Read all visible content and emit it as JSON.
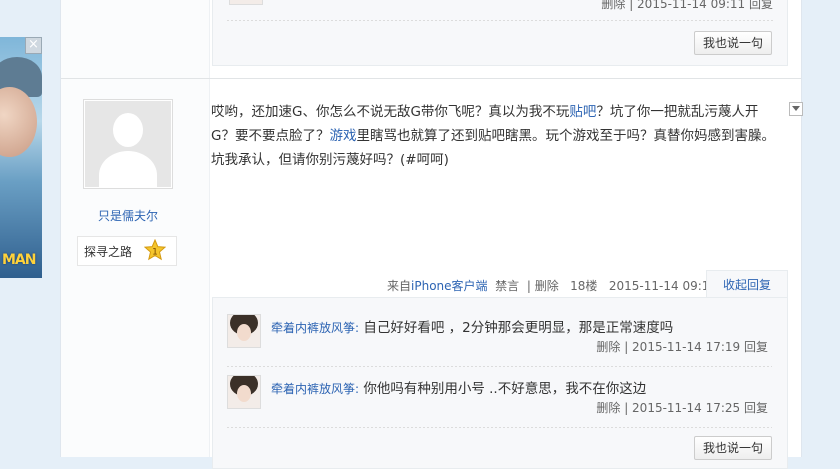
{
  "ad": {
    "close": "×",
    "logo": "MAN"
  },
  "top_reply": {
    "meta": "删除 | 2015-11-14 09:11 回复"
  },
  "reply_btn_label": "我也说一句",
  "post": {
    "author": "只是儒夫尔",
    "badge": "探寻之路",
    "badge_level": "1",
    "content_parts": [
      "哎哟，还加速G、你怎么不说无敌G带你飞呢？真以为我不玩",
      "贴吧",
      "？坑了你一把就乱污蔑人开G？要不要点脸了？",
      "游戏",
      "里瞎骂也就算了还到贴吧瞎黑。玩个游戏至于吗？真替你妈感到害臊。坑我承认，但请你别污蔑好吗？(#呵呵)"
    ],
    "meta": {
      "source_prefix": "来自",
      "source": "iPhone客户端",
      "ban": "禁言",
      "delete": "删除",
      "floor": "18楼",
      "time": "2015-11-14 09:15"
    },
    "collapse": "收起回复"
  },
  "replies": [
    {
      "name": "牵着内裤放风筝:",
      "text": "自己好好看吧 ，2分钟那会更明显，那是正常速度吗",
      "meta": "删除 | 2015-11-14 17:19 回复"
    },
    {
      "name": "牵着内裤放风筝:",
      "text": "你他吗有种别用小号 ..不好意思，我不在你这边",
      "meta": "删除 | 2015-11-14 17:25 回复"
    }
  ]
}
